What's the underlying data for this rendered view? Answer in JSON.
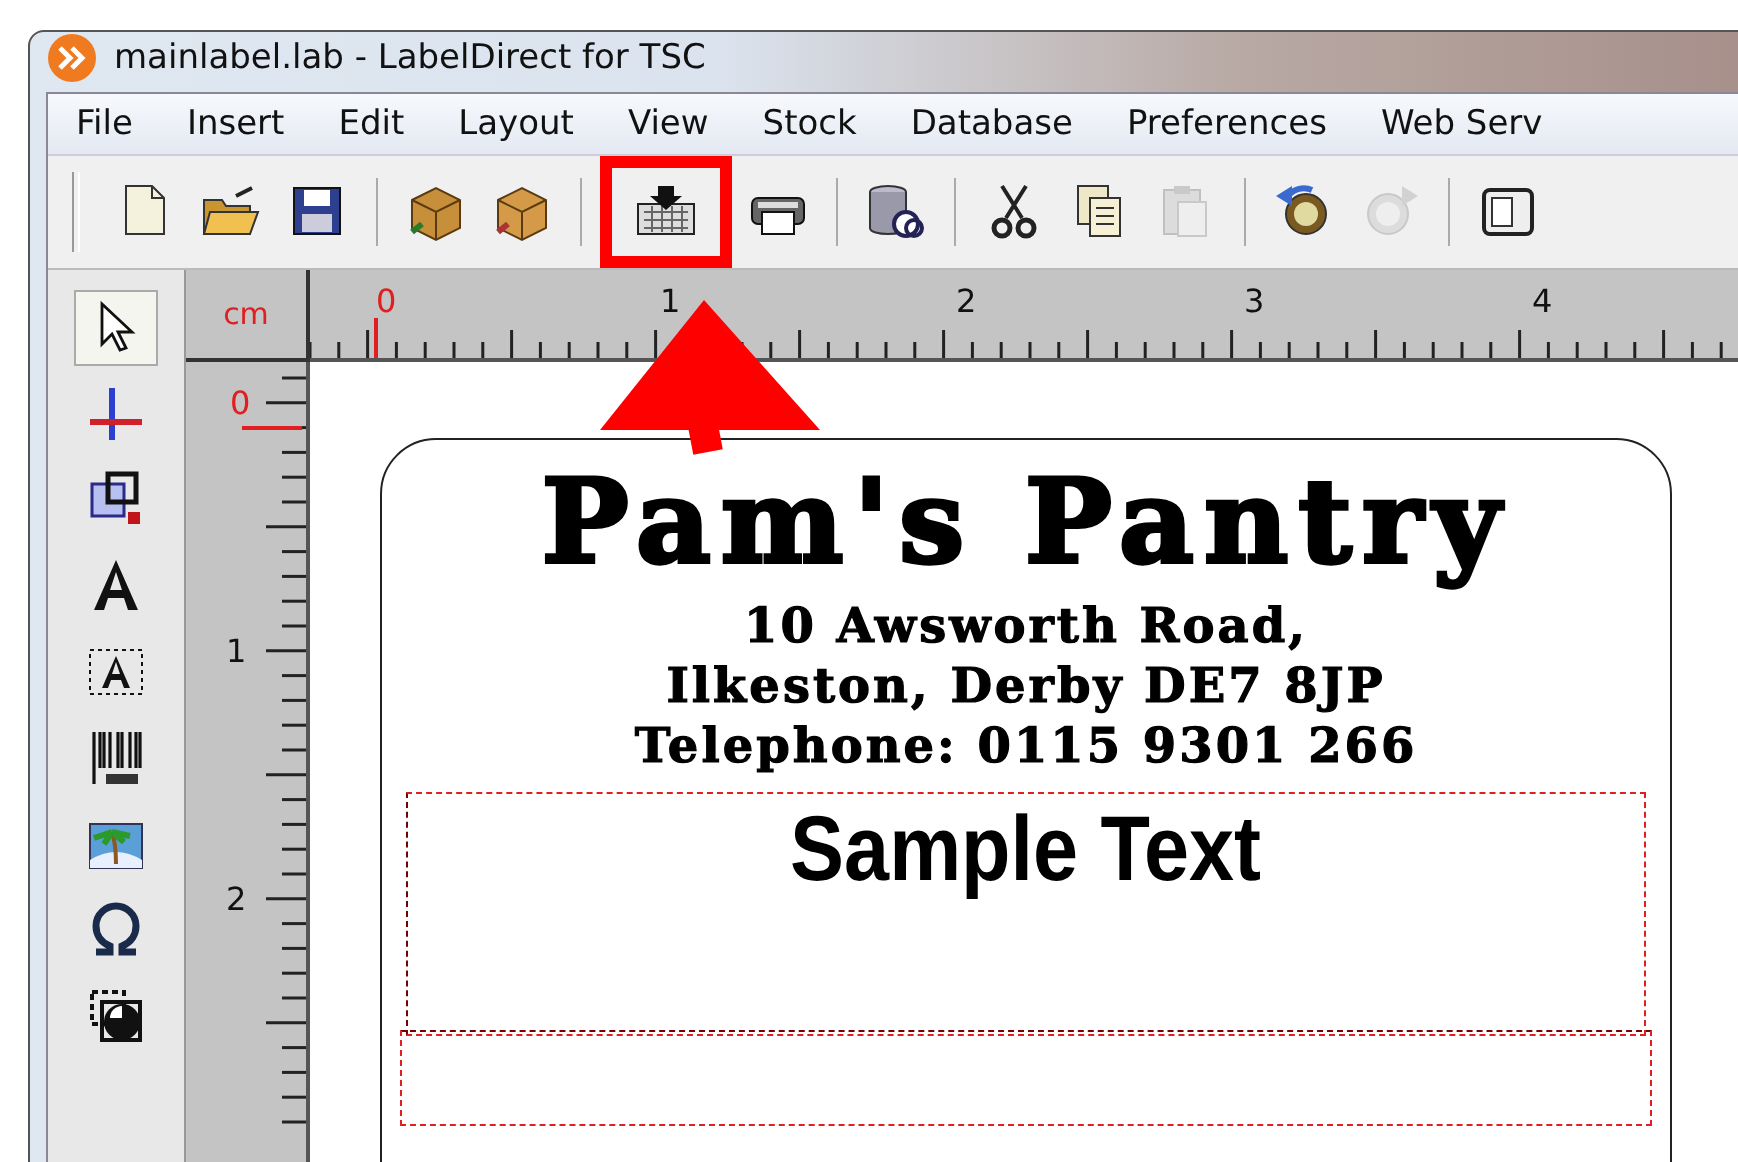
{
  "window": {
    "title": "mainlabel.lab - LabelDirect for TSC"
  },
  "menu": [
    "File",
    "Insert",
    "Edit",
    "Layout",
    "View",
    "Stock",
    "Database",
    "Preferences",
    "Web Serv"
  ],
  "toolbar": [
    {
      "disabled": false,
      "highlighted": false
    },
    {
      "disabled": false,
      "highlighted": false
    },
    {
      "disabled": false,
      "highlighted": false
    },
    {
      "disabled": false,
      "highlighted": false
    },
    {
      "disabled": false,
      "highlighted": false
    },
    {
      "disabled": false,
      "highlighted": true
    },
    {
      "disabled": false,
      "highlighted": false
    },
    {
      "disabled": false,
      "highlighted": false
    },
    {
      "disabled": false,
      "highlighted": false
    },
    {
      "disabled": false,
      "highlighted": false
    },
    {
      "disabled": true,
      "highlighted": false
    },
    {
      "disabled": false,
      "highlighted": false
    },
    {
      "disabled": true,
      "highlighted": false
    },
    {
      "disabled": false,
      "highlighted": false
    }
  ],
  "tools": [
    {
      "selected": true
    },
    {
      "selected": false
    },
    {
      "selected": false
    },
    {
      "selected": false
    },
    {
      "selected": false
    },
    {
      "selected": false
    },
    {
      "selected": false
    },
    {
      "selected": false
    },
    {
      "selected": false
    }
  ],
  "ruler": {
    "unit": "cm",
    "x_labels": [
      "0",
      "1",
      "2",
      "3",
      "4"
    ],
    "y_labels": [
      "0",
      "1",
      "2"
    ]
  },
  "label": {
    "title": "Pam's Pantry",
    "lines": [
      "10 Awsworth Road,",
      "Ilkeston, Derby DE7 8JP",
      "Telephone: 0115 9301 266"
    ],
    "text_fields": [
      "Sample Text"
    ]
  }
}
